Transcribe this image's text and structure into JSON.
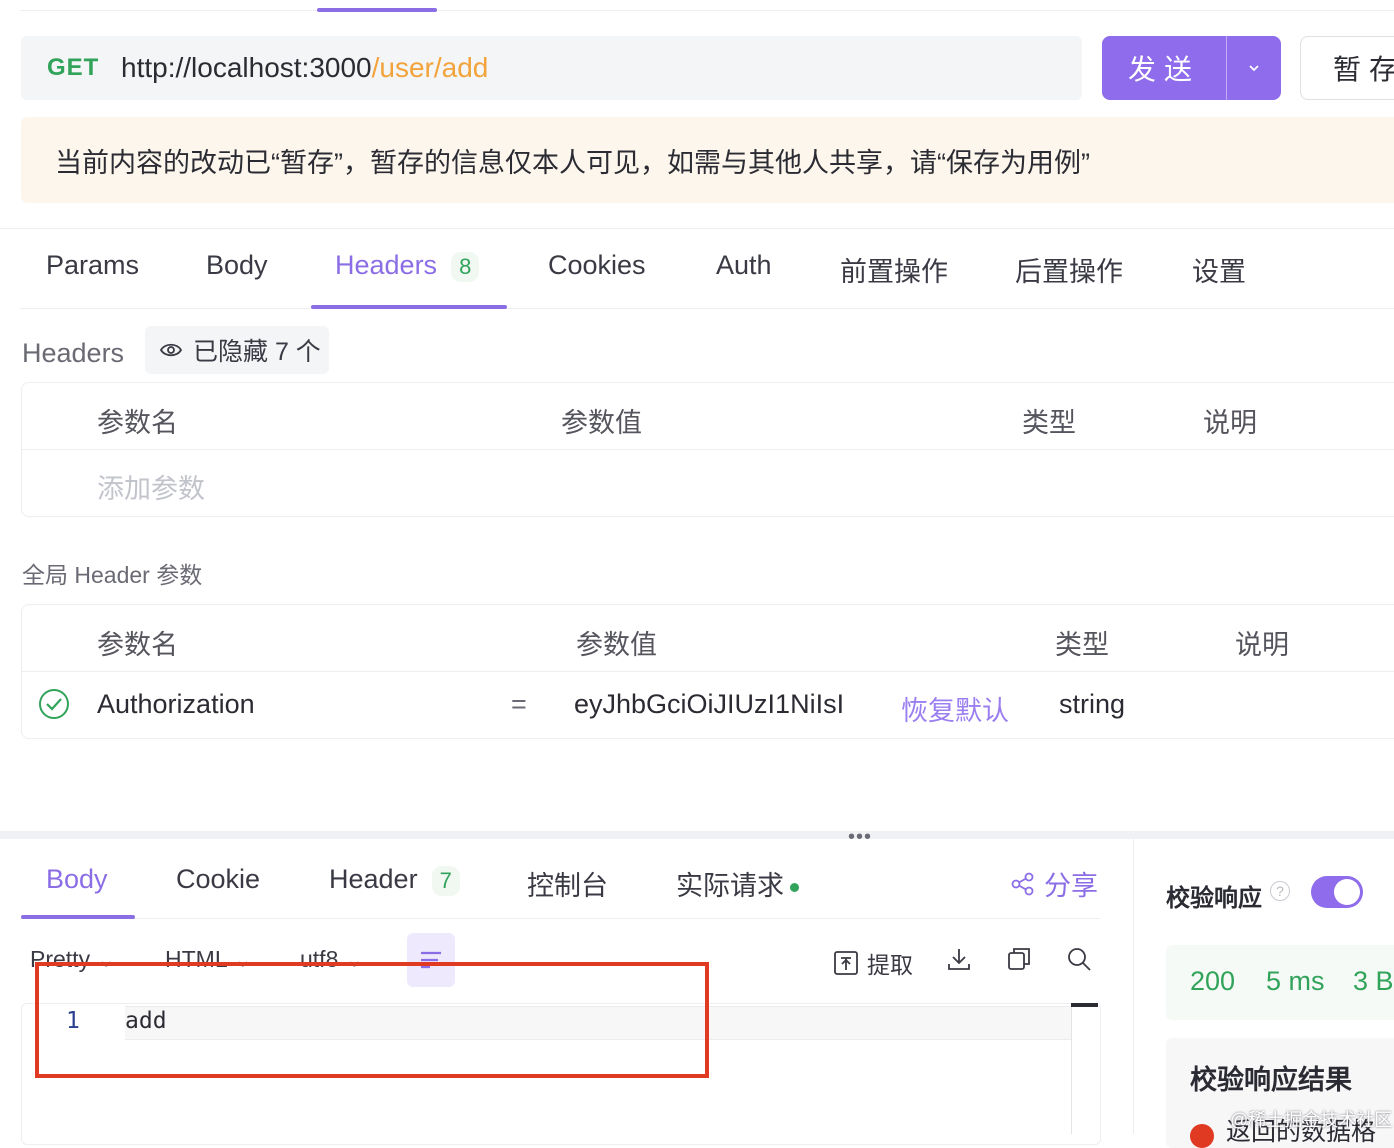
{
  "request": {
    "method": "GET",
    "url_base": "http://localhost:3000",
    "url_path": "/user/add",
    "send_label": "发送",
    "send_caret": "⌄",
    "save_label": "暂存"
  },
  "notice": "当前内容的改动已“暂存”，暂存的信息仅本人可见，如需与其他人共享，请“保存为用例”",
  "request_tabs": [
    {
      "label": "Params"
    },
    {
      "label": "Body"
    },
    {
      "label": "Headers",
      "badge": "8"
    },
    {
      "label": "Cookies"
    },
    {
      "label": "Auth"
    },
    {
      "label": "前置操作"
    },
    {
      "label": "后置操作"
    },
    {
      "label": "设置"
    }
  ],
  "headers_section": {
    "title": "Headers",
    "hidden_chip": "已隐藏 7 个",
    "columns": [
      "参数名",
      "参数值",
      "类型",
      "说明"
    ],
    "add_placeholder": "添加参数"
  },
  "global_section": {
    "title": "全局 Header 参数",
    "columns": [
      "参数名",
      "参数值",
      "类型",
      "说明"
    ],
    "row": {
      "name": "Authorization",
      "equals": "=",
      "value": "eyJhbGciOiJIUzI1NiIsI",
      "restore": "恢复默认",
      "type": "string"
    }
  },
  "splitter_dots": "•••",
  "response_tabs": [
    {
      "label": "Body"
    },
    {
      "label": "Cookie"
    },
    {
      "label": "Header",
      "badge": "7"
    },
    {
      "label": "控制台"
    },
    {
      "label": "实际请求"
    }
  ],
  "share_label": "分享",
  "toolbar": {
    "format": "Pretty",
    "type": "HTML",
    "encoding": "utf8",
    "extract": "提取"
  },
  "editor": {
    "line_number": "1",
    "code": "add"
  },
  "right_panel": {
    "verify_label": "校验响应",
    "help": "?",
    "status_code": "200",
    "time": "5 ms",
    "size": "3 B",
    "result_title": "校验响应结果",
    "result_text": "返回的数据格"
  },
  "watermark": "@稀土掘金技术社区",
  "colors": {
    "accent": "#8b6ee6",
    "send_button": "#8e6cec",
    "method_get": "#31a35a",
    "url_path": "#f2a33b",
    "notice_bg": "#fdf6ec",
    "highlight_box": "#e03a22"
  }
}
